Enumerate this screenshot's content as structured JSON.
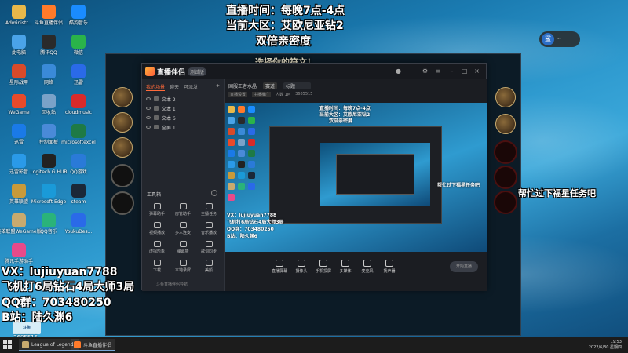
{
  "overlay_top": {
    "line1": "直播时间：每晚7点-4点",
    "line2": "当前大区：艾欧尼亚钻2",
    "line3": "双倍亲密度"
  },
  "overlay_left": {
    "vx": "VX：lujiuyuan7788",
    "record": "飞机打6局钻石4局大师3局",
    "qq": "QQ群：703480250",
    "bili": "B站：陆久渊6"
  },
  "right_message": "帮忙过下福星任务吧",
  "desktop_icons": [
    {
      "label": "Administr...",
      "color": "#e8b84a"
    },
    {
      "label": "斗鱼直播伴侣",
      "color": "#ff7a2a"
    },
    {
      "label": "酷狗音乐",
      "color": "#1a8cff"
    },
    {
      "label": "此电脑",
      "color": "#4aa3e8"
    },
    {
      "label": "腾讯QQ",
      "color": "#2a2a2a"
    },
    {
      "label": "微信",
      "color": "#2ab34a"
    },
    {
      "label": "星际战甲",
      "color": "#d84a2a"
    },
    {
      "label": "网络",
      "color": "#3a8ad8"
    },
    {
      "label": "迅雷",
      "color": "#2a6ae8"
    },
    {
      "label": "WeGame",
      "color": "#e84a2a"
    },
    {
      "label": "回收站",
      "color": "#7aa2c8"
    },
    {
      "label": "cloudmusic",
      "color": "#d82a2a"
    },
    {
      "label": "迅雷",
      "color": "#1a7ae8"
    },
    {
      "label": "控制面板",
      "color": "#4a8ad8"
    },
    {
      "label": "microsoftexcel",
      "color": "#1e7a45"
    },
    {
      "label": "迅雷影音",
      "color": "#2a9ae8"
    },
    {
      "label": "Logitech G HUB",
      "color": "#222222"
    },
    {
      "label": "QQ游戏",
      "color": "#2a7ad8"
    },
    {
      "label": "英雄联盟",
      "color": "#c89a3a"
    },
    {
      "label": "Microsoft Edge",
      "color": "#1a9ad8"
    },
    {
      "label": "steam",
      "color": "#1b2838"
    },
    {
      "label": "英雄联盟WeGame版",
      "color": "#c8aa6e"
    },
    {
      "label": "QQ音乐",
      "color": "#2ab37a"
    },
    {
      "label": "YoukuDes...",
      "color": "#2a6ae8"
    },
    {
      "label": "腾讯手游助手",
      "color": "#e84a8a"
    }
  ],
  "game_window": {
    "title": "选择你的符文！"
  },
  "companion_app": {
    "app_name": "直播伴侣",
    "version_badge": "测试版",
    "tabs": [
      "我的场景",
      "聊天",
      "可派发"
    ],
    "scenes": [
      "文本 2",
      "文本 1",
      "文本 6",
      "全屏 1"
    ],
    "toolbox_label": "工具箱",
    "tools": [
      "弹幕助手",
      "房管助手",
      "主播任务",
      "视频播放",
      "多人连麦",
      "音乐播放",
      "虚拟形象",
      "弹幕墙",
      "歌词同步",
      "下载",
      "本地录屏",
      "美颜"
    ],
    "footer_note": "斗鱼直播伴侣导航",
    "room_info": [
      "国服王者水晶",
      "赛道",
      "标题"
    ],
    "room_sub": [
      "直播设置",
      "主播推广",
      "人数 1M",
      "3685515"
    ],
    "preview_text": {
      "l1": "直播时间：每晚7点-4点",
      "l2": "当前大区：艾欧尼亚钻2",
      "l3": "双倍亲密度",
      "vx": "VX：lujiuyuan7788",
      "rec": "飞机打6局钻石4局大师3局",
      "qq": "QQ群：703480250",
      "bili": "B站：陆久渊6",
      "rmsg": "帮忙过下福星任务吧"
    },
    "controls": [
      "直播屏幕",
      "摄像头",
      "手机投屏",
      "多媒体",
      "麦克风",
      "扬声器"
    ],
    "start_label": "开始直播"
  },
  "stream_control": {
    "avatar": "鲨",
    "status": "···"
  },
  "watermark": {
    "label": "斗鱼",
    "room": "3685515"
  },
  "taskbar": {
    "apps": [
      {
        "label": "League of Legends",
        "color": "#c8aa6e"
      },
      {
        "label": "斗鱼直播伴侣",
        "color": "#ff7a2a"
      }
    ],
    "time": "19:53",
    "date": "2022/6/30 星期四"
  }
}
